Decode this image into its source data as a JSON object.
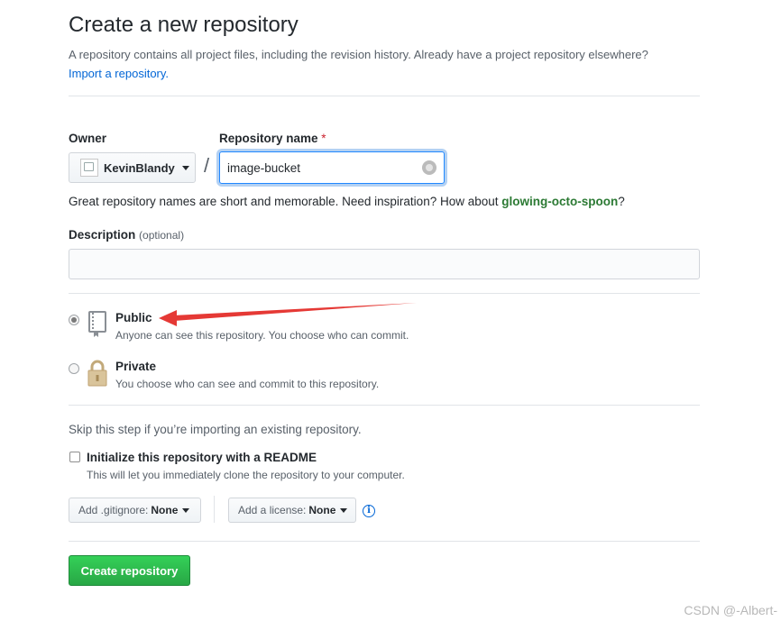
{
  "header": {
    "title": "Create a new repository",
    "subtitle": "A repository contains all project files, including the revision history. Already have a project repository elsewhere?",
    "import_link": "Import a repository."
  },
  "owner": {
    "label": "Owner",
    "selected": "KevinBlandy"
  },
  "repo_name": {
    "label": "Repository name",
    "required_mark": "*",
    "value": "image-bucket"
  },
  "name_hint": {
    "text": "Great repository names are short and memorable. Need inspiration? How about",
    "suggestion": "glowing-octo-spoon",
    "end": "?"
  },
  "description": {
    "label": "Description",
    "optional": "(optional)",
    "value": ""
  },
  "visibility": {
    "public_title": "Public",
    "public_desc": "Anyone can see this repository. You choose who can commit.",
    "private_title": "Private",
    "private_desc": "You choose who can see and commit to this repository.",
    "selected": "public"
  },
  "init": {
    "skip_text": "Skip this step if you’re importing an existing repository.",
    "readme_label": "Initialize this repository with a README",
    "readme_desc": "This will let you immediately clone the repository to your computer."
  },
  "gitignore": {
    "label": "Add .gitignore:",
    "value": "None"
  },
  "license": {
    "label": "Add a license:",
    "value": "None"
  },
  "info_icon": "i",
  "submit_label": "Create repository",
  "watermark": "CSDN @-Albert-",
  "colors": {
    "primary_button": "#28a745",
    "link": "#0366d6",
    "suggestion": "#2c7a34",
    "arrow": "#e53935"
  }
}
